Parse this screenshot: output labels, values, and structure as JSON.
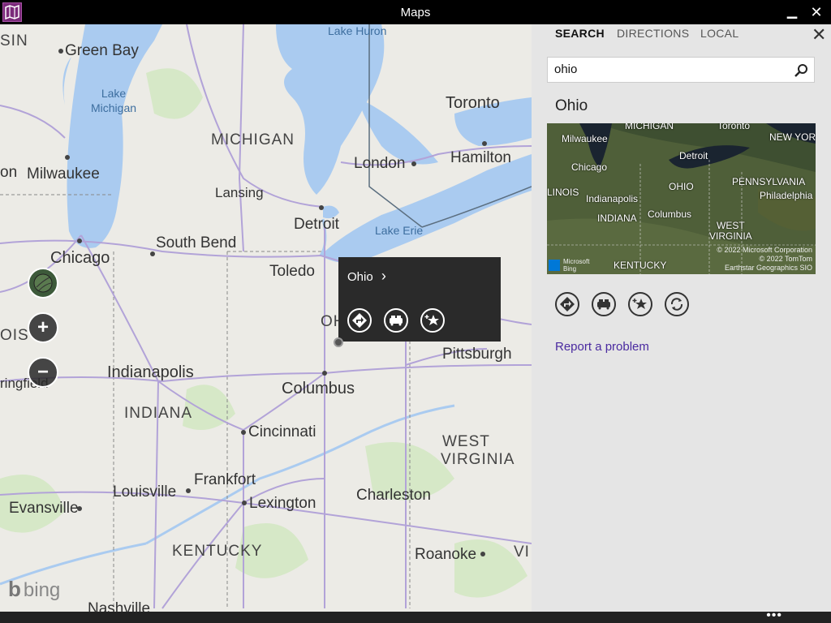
{
  "window": {
    "title": "Maps",
    "minimize_glyph": "▁",
    "close_glyph": "✕"
  },
  "map": {
    "labels": {
      "sin": "SIN",
      "green_bay": "Green Bay",
      "lake_michigan": "Lake\nMichigan",
      "lake_huron": "Lake Huron",
      "michigan": "MICHIGAN",
      "toronto": "Toronto",
      "hamilton": "Hamilton",
      "on": "on",
      "milwaukee": "Milwaukee",
      "lansing": "Lansing",
      "london": "London",
      "detroit": "Detroit",
      "lake_erie": "Lake Erie",
      "chicago": "Chicago",
      "south_bend": "South Bend",
      "toledo": "Toledo",
      "ois": "OIS",
      "oh": "OH",
      "pittsburgh": "Pittsburgh",
      "ringfield": "ringfield",
      "indianapolis": "Indianapolis",
      "columbus": "Columbus",
      "indiana": "INDIANA",
      "cincinnati": "Cincinnati",
      "west": "WEST",
      "virginia": "VIRGINIA",
      "frankfort": "Frankfort",
      "louisville": "Louisville",
      "charleston": "Charleston",
      "evansville": "Evansville",
      "lexington": "Lexington",
      "kentucky": "KENTUCKY",
      "roanoke": "Roanoke",
      "vi": "VI",
      "nashville": "Nashville"
    },
    "controls": {
      "zoom_in": "+",
      "zoom_out": "−"
    },
    "popup": {
      "title": "Ohio",
      "chevron": "›"
    },
    "logo": "bing"
  },
  "panel": {
    "tabs": [
      {
        "label": "SEARCH",
        "active": true
      },
      {
        "label": "DIRECTIONS",
        "active": false
      },
      {
        "label": "LOCAL",
        "active": false
      }
    ],
    "close_glyph": "✕",
    "search": {
      "value": "ohio"
    },
    "result": {
      "title": "Ohio",
      "aerial_labels": {
        "michigan": "MICHIGAN",
        "toronto": "Toronto",
        "milwaukee": "Milwaukee",
        "detroit": "Detroit",
        "new_york": "NEW YORK",
        "chicago": "Chicago",
        "pennsylvania": "PENNSYLVANIA",
        "linois": "LINOIS",
        "ohio": "OHIO",
        "indianapolis": "Indianapolis",
        "philadelphia": "Philadelphia",
        "indiana": "INDIANA",
        "columbus": "Columbus",
        "west_virginia": "WEST\nVIRGINIA",
        "kentucky": "KENTUCKY",
        "copyright1": "© 2022 Microsoft Corporation",
        "copyright2": "© 2022 TomTom",
        "copyright3": "Earthstar Geographics  SIO",
        "ms_bing": "Microsoft\nBing"
      }
    },
    "report_link": "Report a problem"
  },
  "appbar": {
    "more": "•••"
  },
  "colors": {
    "accent": "#7b2a7a",
    "link": "#4a2aa0",
    "water": "#aacbf0",
    "land": "#ecebe6"
  }
}
